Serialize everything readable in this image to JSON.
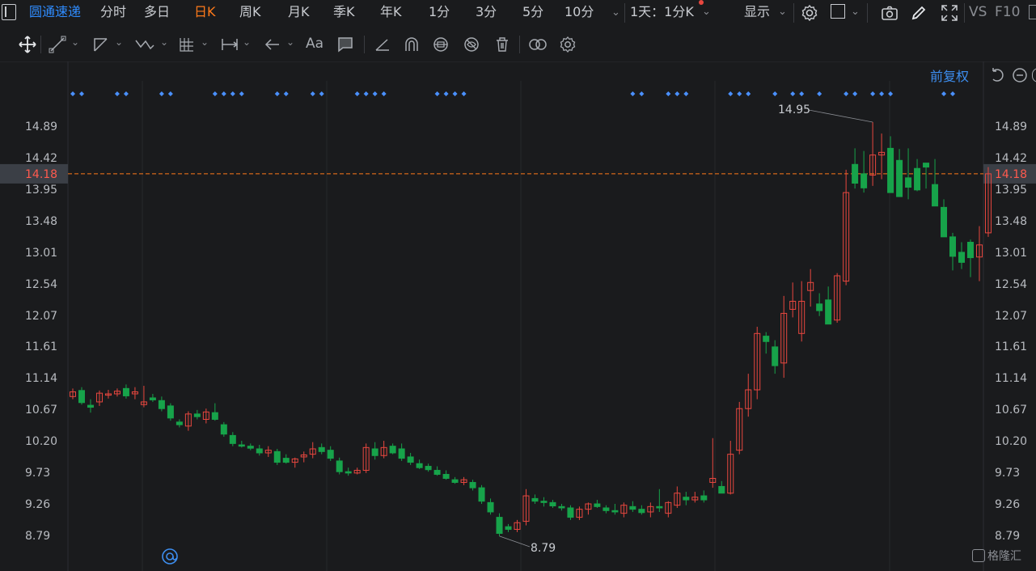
{
  "stock_name": "圆通速递",
  "periods": [
    {
      "label": "分时",
      "active": false
    },
    {
      "label": "多日",
      "active": false
    },
    {
      "label": "日K",
      "active": true
    },
    {
      "label": "周K",
      "active": false
    },
    {
      "label": "月K",
      "active": false
    },
    {
      "label": "季K",
      "active": false
    },
    {
      "label": "年K",
      "active": false
    },
    {
      "label": "1分",
      "active": false
    },
    {
      "label": "3分",
      "active": false
    },
    {
      "label": "5分",
      "active": false
    },
    {
      "label": "10分",
      "active": false
    }
  ],
  "range_selector": "1天：1分K",
  "display_label": "显示",
  "vs_label": "VS",
  "f10_label": "F10",
  "adjust_label": "前复权",
  "watermark": "格隆汇",
  "colors": {
    "up": "#e8473f",
    "down": "#17a34a",
    "accent": "#ff7a1a",
    "blue": "#2f8cff",
    "marker": "#4a90ff"
  },
  "chart_data": {
    "type": "candlestick",
    "y_ticks": [
      "14.89",
      "14.42",
      "13.95",
      "13.48",
      "13.01",
      "12.54",
      "12.07",
      "11.61",
      "11.14",
      "10.67",
      "10.20",
      "9.73",
      "9.26",
      "8.79"
    ],
    "ylim": [
      8.79,
      14.89
    ],
    "current_price": "14.18",
    "max_label": "14.95",
    "min_label": "8.79",
    "candles": [
      [
        10.86,
        10.98,
        10.82,
        10.93
      ],
      [
        10.95,
        11.0,
        10.74,
        10.77
      ],
      [
        10.73,
        10.82,
        10.62,
        10.7
      ],
      [
        10.78,
        10.95,
        10.72,
        10.91
      ],
      [
        10.88,
        10.96,
        10.83,
        10.9
      ],
      [
        10.9,
        10.98,
        10.86,
        10.94
      ],
      [
        10.98,
        11.04,
        10.83,
        10.87
      ],
      [
        10.9,
        11.0,
        10.82,
        10.93
      ],
      [
        10.74,
        11.02,
        10.7,
        10.78
      ],
      [
        10.84,
        10.9,
        10.78,
        10.81
      ],
      [
        10.8,
        10.86,
        10.64,
        10.68
      ],
      [
        10.72,
        10.76,
        10.5,
        10.54
      ],
      [
        10.48,
        10.52,
        10.4,
        10.44
      ],
      [
        10.42,
        10.64,
        10.35,
        10.6
      ],
      [
        10.6,
        10.66,
        10.52,
        10.56
      ],
      [
        10.52,
        10.68,
        10.46,
        10.63
      ],
      [
        10.62,
        10.76,
        10.5,
        10.52
      ],
      [
        10.44,
        10.48,
        10.26,
        10.3
      ],
      [
        10.28,
        10.33,
        10.12,
        10.16
      ],
      [
        10.14,
        10.2,
        10.1,
        10.12
      ],
      [
        10.12,
        10.16,
        10.06,
        10.09
      ],
      [
        10.08,
        10.14,
        9.98,
        10.02
      ],
      [
        10.02,
        10.12,
        9.96,
        10.06
      ],
      [
        10.04,
        10.08,
        9.84,
        9.88
      ],
      [
        9.94,
        10.0,
        9.86,
        9.88
      ],
      [
        9.88,
        9.95,
        9.8,
        9.93
      ],
      [
        9.96,
        10.04,
        9.88,
        9.99
      ],
      [
        10.0,
        10.18,
        9.94,
        10.08
      ],
      [
        10.1,
        10.16,
        10.0,
        10.04
      ],
      [
        10.06,
        10.12,
        9.9,
        9.94
      ],
      [
        9.9,
        9.95,
        9.7,
        9.74
      ],
      [
        9.74,
        9.8,
        9.68,
        9.72
      ],
      [
        9.72,
        9.8,
        9.7,
        9.76
      ],
      [
        9.76,
        10.16,
        9.72,
        10.1
      ],
      [
        10.08,
        10.18,
        9.92,
        9.98
      ],
      [
        9.98,
        10.2,
        9.94,
        10.1
      ],
      [
        10.12,
        10.16,
        10.0,
        10.02
      ],
      [
        10.08,
        10.16,
        9.9,
        9.94
      ],
      [
        9.96,
        10.02,
        9.84,
        9.88
      ],
      [
        9.86,
        9.92,
        9.78,
        9.8
      ],
      [
        9.82,
        9.86,
        9.74,
        9.77
      ],
      [
        9.76,
        9.82,
        9.68,
        9.7
      ],
      [
        9.7,
        9.76,
        9.62,
        9.64
      ],
      [
        9.62,
        9.66,
        9.56,
        9.58
      ],
      [
        9.58,
        9.66,
        9.54,
        9.62
      ],
      [
        9.58,
        9.62,
        9.46,
        9.5
      ],
      [
        9.5,
        9.54,
        9.26,
        9.3
      ],
      [
        9.28,
        9.34,
        9.1,
        9.14
      ],
      [
        9.06,
        9.12,
        8.78,
        8.82
      ],
      [
        8.92,
        8.96,
        8.84,
        8.88
      ],
      [
        8.88,
        9.02,
        8.84,
        8.98
      ],
      [
        9.0,
        9.48,
        8.94,
        9.38
      ],
      [
        9.34,
        9.4,
        9.26,
        9.3
      ],
      [
        9.3,
        9.36,
        9.22,
        9.28
      ],
      [
        9.28,
        9.32,
        9.2,
        9.23
      ],
      [
        9.22,
        9.26,
        9.16,
        9.2
      ],
      [
        9.2,
        9.24,
        9.02,
        9.06
      ],
      [
        9.06,
        9.22,
        9.02,
        9.18
      ],
      [
        9.18,
        9.28,
        9.1,
        9.26
      ],
      [
        9.26,
        9.32,
        9.2,
        9.22
      ],
      [
        9.2,
        9.24,
        9.12,
        9.16
      ],
      [
        9.16,
        9.26,
        9.1,
        9.14
      ],
      [
        9.12,
        9.28,
        9.06,
        9.24
      ],
      [
        9.22,
        9.3,
        9.14,
        9.18
      ],
      [
        9.18,
        9.24,
        9.1,
        9.13
      ],
      [
        9.14,
        9.28,
        9.06,
        9.22
      ],
      [
        9.22,
        9.48,
        9.14,
        9.2
      ],
      [
        9.12,
        9.3,
        9.06,
        9.28
      ],
      [
        9.24,
        9.52,
        9.2,
        9.42
      ],
      [
        9.36,
        9.44,
        9.24,
        9.32
      ],
      [
        9.32,
        9.44,
        9.28,
        9.36
      ],
      [
        9.38,
        9.46,
        9.28,
        9.32
      ],
      [
        9.58,
        10.24,
        9.5,
        9.64
      ],
      [
        9.52,
        9.6,
        9.42,
        9.42
      ],
      [
        9.42,
        10.2,
        9.4,
        10.0
      ],
      [
        10.06,
        10.78,
        10.0,
        10.68
      ],
      [
        10.68,
        11.2,
        10.56,
        10.96
      ],
      [
        10.96,
        11.9,
        10.82,
        11.8
      ],
      [
        11.76,
        11.82,
        11.5,
        11.68
      ],
      [
        11.6,
        11.7,
        11.2,
        11.32
      ],
      [
        11.36,
        12.36,
        11.14,
        12.1
      ],
      [
        12.16,
        12.56,
        12.04,
        12.28
      ],
      [
        11.8,
        12.58,
        11.68,
        12.28
      ],
      [
        12.44,
        12.76,
        12.2,
        12.56
      ],
      [
        12.24,
        12.4,
        12.06,
        12.14
      ],
      [
        12.3,
        12.5,
        11.98,
        11.94
      ],
      [
        12.0,
        12.7,
        11.96,
        12.66
      ],
      [
        12.58,
        14.24,
        12.52,
        13.9
      ],
      [
        14.32,
        14.56,
        13.96,
        14.04
      ],
      [
        14.18,
        14.52,
        13.9,
        13.97
      ],
      [
        14.16,
        14.95,
        14.0,
        14.46
      ],
      [
        14.46,
        14.78,
        14.1,
        14.5
      ],
      [
        14.56,
        14.74,
        13.9,
        13.9
      ],
      [
        14.38,
        14.55,
        13.84,
        13.84
      ],
      [
        14.12,
        14.56,
        13.8,
        13.98
      ],
      [
        14.26,
        14.4,
        13.92,
        13.94
      ],
      [
        14.34,
        14.28,
        13.96,
        14.28
      ],
      [
        14.02,
        14.4,
        13.76,
        13.7
      ],
      [
        13.68,
        13.8,
        13.26,
        13.24
      ],
      [
        13.24,
        13.3,
        12.74,
        12.95
      ],
      [
        13.01,
        13.16,
        12.76,
        12.86
      ],
      [
        13.16,
        13.2,
        12.64,
        12.93
      ],
      [
        12.94,
        13.4,
        12.58,
        13.12
      ],
      [
        13.3,
        14.28,
        13.24,
        14.18
      ]
    ]
  }
}
